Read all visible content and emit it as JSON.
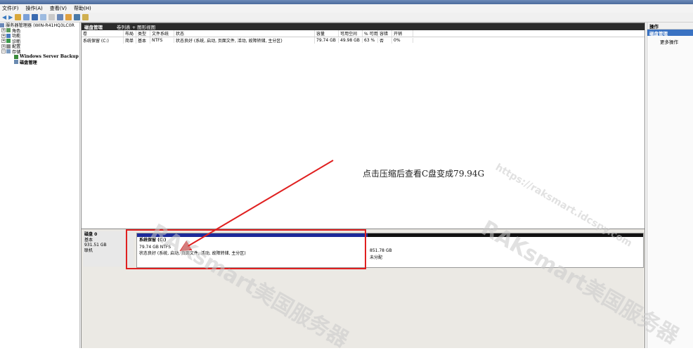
{
  "menu": [
    "文件(F)",
    "操作(A)",
    "查看(V)",
    "帮助(H)"
  ],
  "tree": {
    "root": "服务器管理器 (WIN-R41HQ3LC0R",
    "roles": "角色",
    "features": "功能",
    "diagnostics": "诊断",
    "config": "配置",
    "storage": "存储",
    "backup": "Windows Server Backup",
    "diskmgmt": "磁盘管理"
  },
  "main": {
    "title": "磁盘管理",
    "view": "卷列表 + 图形视图",
    "columns": [
      "卷",
      "布局",
      "类型",
      "文件系统",
      "状态",
      "容量",
      "可用空间",
      "% 可用",
      "容错",
      "开销"
    ],
    "volumes": [
      [
        "系统保留 (C:)",
        "简单",
        "基本",
        "NTFS",
        "状态良好 (系统, 启动, 页面文件, 活动, 故障转储, 主分区)",
        "79.74 GB",
        "49.98 GB",
        "63 %",
        "否",
        "0%"
      ]
    ]
  },
  "annotation": "点击压缩后查看C盘变成79.94G",
  "disk": {
    "name": "磁盘 0",
    "type": "基本",
    "size": "931.51 GB",
    "status": "联机"
  },
  "partitions": {
    "c_name": "系统保留 (C:)",
    "c_size": "79.74 GB NTFS",
    "c_status": "状态良好 (系统, 启动, 页面文件, 活动, 故障转储, 主分区)",
    "u_size": "851.78 GB",
    "u_status": "未分配"
  },
  "actions": {
    "header": "操作",
    "selected": "磁盘管理",
    "more": "更多操作"
  },
  "watermarks": [
    "RAKsmart美国服务器",
    "https://raksmart.idcspy.com",
    "RAKsmart美国服务器"
  ],
  "colors": {
    "accent": "#e02020",
    "partition_primary": "#1c2a9a",
    "unallocated": "#111111"
  }
}
